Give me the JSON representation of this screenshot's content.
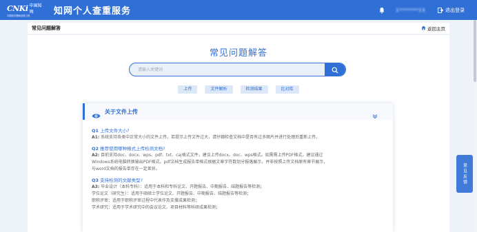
{
  "header": {
    "logo_text": "CNKi中国知网",
    "logo_cn": "中国知网",
    "logo_sub": "中国知识基础设施工程",
    "app_title": "知网个人查重服务",
    "user_id": "1*******13",
    "logout_label": "退出登录"
  },
  "subbar": {
    "title": "常见问题解答",
    "home_label": "返回主页"
  },
  "main": {
    "heading": "常见问题解答",
    "search_placeholder": "请输入关键词",
    "tags": [
      "上传",
      "文件解析",
      "检测结果",
      "比对库"
    ]
  },
  "faq": {
    "section_title": "关于文件上传",
    "items": [
      {
        "num": "Q1",
        "question": "上传文件大小?",
        "answer_label": "A1:",
        "answer_lines": [
          "系统支持各类中正常大小的文件上传。若提示上传文件过大，请仔细检查文档中是否有过多图片并进行处理后重新上传。"
        ]
      },
      {
        "num": "Q2",
        "question": "推荐使用哪种格式上传检测文档?",
        "answer_label": "A2:",
        "answer_lines": [
          "目前支持doc、docx、wps、pdf、txt、caj格式文件，建议上传docx、doc、wps格式。如需需上传PDF格式，建议通过",
          "Windows系统电脑转换输出PDF格式。pdf文档生成报告单格式根据文章字符数划分报落展示，并非按照上传文档原有章节展示，",
          "与word文档的报告单存在一定差异。"
        ]
      },
      {
        "num": "Q3",
        "question": "支持检测的文献类型?",
        "answer_label": "A3:",
        "answer_lines": [
          "毕业设计（本科专科）：适用于本科和专科论文、开题报告、中期报告、结题报告等检测；",
          "学位论文（研究生）：适用于硕硕士学位论文、开题报告、中期报告、结题报告等检测；",
          "职称评审：适用于职称评审过程中代表作及支撑成果检测；",
          "学术研究：适用于学术研究中的会议论文、项目材料等科研成果检测；"
        ]
      }
    ]
  },
  "feedback": {
    "label": "意见反馈"
  },
  "colors": {
    "primary": "#2f6fd6",
    "tag_bg": "#dce8f8",
    "page_bg": "#eef3fa"
  },
  "icons": [
    "bell-icon",
    "logout-icon",
    "home-icon",
    "search-icon",
    "eye-icon",
    "chevron-down-icon"
  ]
}
